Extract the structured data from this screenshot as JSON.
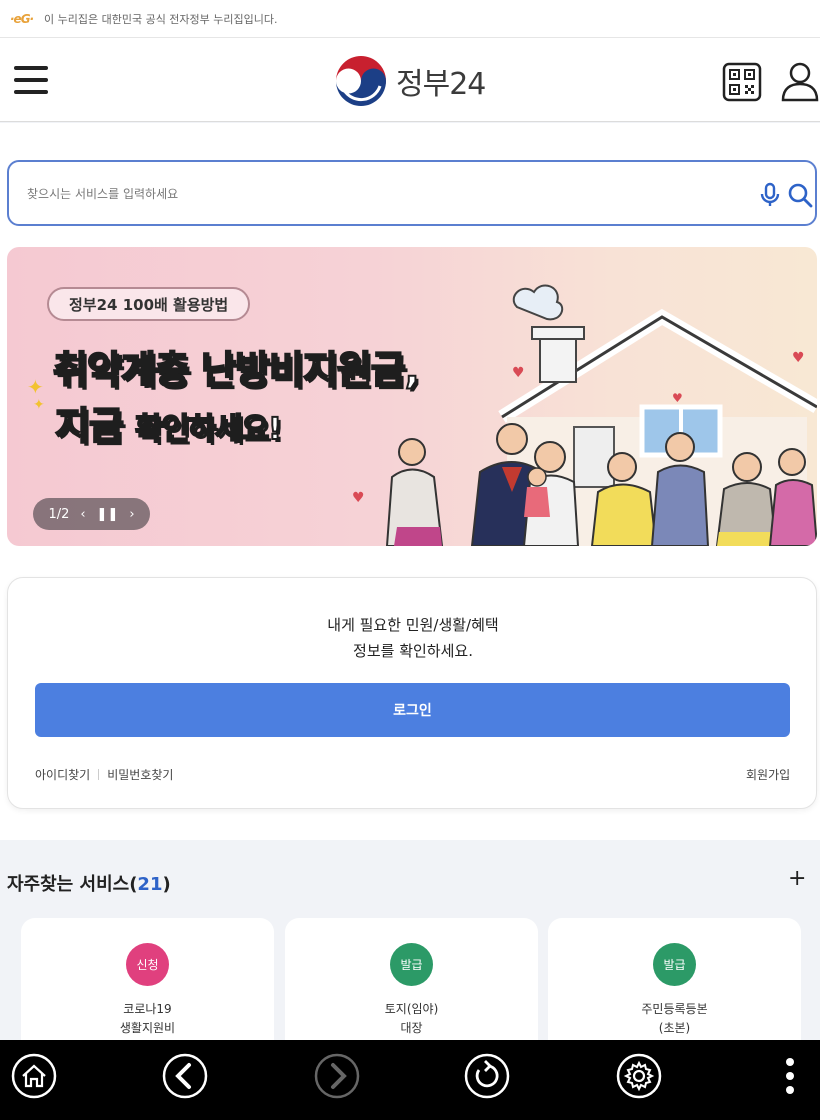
{
  "gov_strip": {
    "text": "이 누리집은 대한민국 공식 전자정부 누리집입니다."
  },
  "header": {
    "logo_text": "정부24"
  },
  "search": {
    "placeholder": "찾으시는 서비스를 입력하세요"
  },
  "banner": {
    "tag": "정부24 100배 활용방법",
    "title_line1": "취약계층 난방비지원금,",
    "title_line2_big": "지금",
    "title_line2_small": "확인하세요!",
    "pager": {
      "current": "1/2"
    }
  },
  "login_card": {
    "message_line1": "내게 필요한 민원/생활/혜택",
    "message_line2": "정보를 확인하세요.",
    "login_button": "로그인",
    "find_id": "아이디찾기",
    "find_password": "비밀번호찾기",
    "signup": "회원가입"
  },
  "frequent_services": {
    "title": "자주찾는 서비스",
    "count_open": "(",
    "count": "21",
    "count_close": ")",
    "items": [
      {
        "badge": "신청",
        "badge_color": "#e0407e",
        "name_line1": "코로나19",
        "name_line2": "생활지원비"
      },
      {
        "badge": "발급",
        "badge_color": "#2c9a67",
        "name_line1": "토지(임야)",
        "name_line2": "대장"
      },
      {
        "badge": "발급",
        "badge_color": "#2c9a67",
        "name_line1": "주민등록등본",
        "name_line2": "(초본)"
      }
    ]
  },
  "colors": {
    "accent": "#4c7fe0",
    "search_border": "#5b7fd0",
    "count": "#2e63c8"
  }
}
